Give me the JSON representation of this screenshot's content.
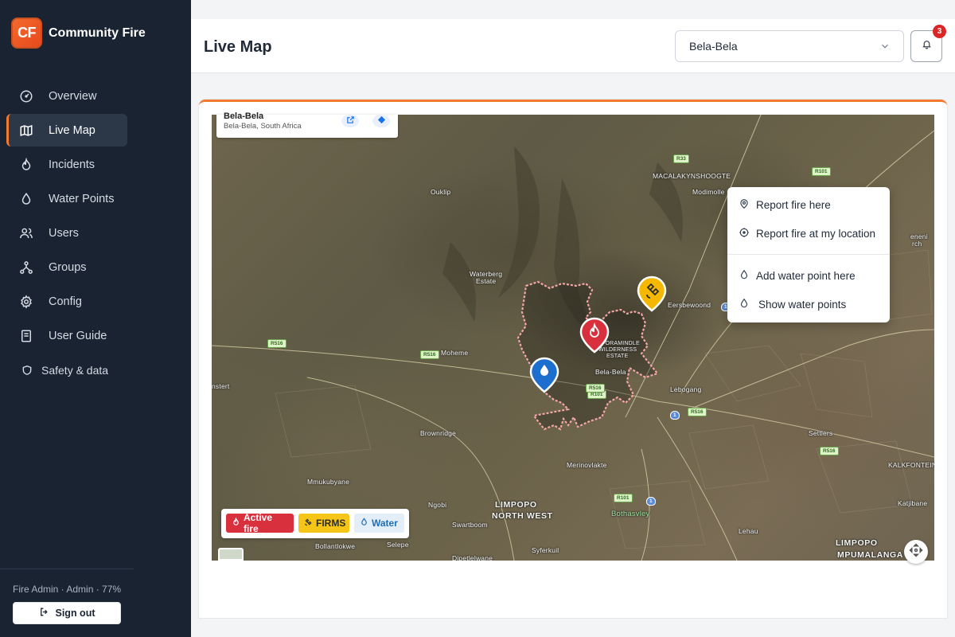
{
  "brand": {
    "logo_text": "CF",
    "name": "Community Fire",
    "accent": "#f07a2e"
  },
  "sidebar": {
    "items": [
      {
        "label": "Overview",
        "icon": "gauge-icon"
      },
      {
        "label": "Live Map",
        "icon": "map-icon",
        "active": true
      },
      {
        "label": "Incidents",
        "icon": "flame-icon"
      },
      {
        "label": "Water Points",
        "icon": "droplet-icon"
      },
      {
        "label": "Users",
        "icon": "users-icon"
      },
      {
        "label": "Groups",
        "icon": "network-icon"
      },
      {
        "label": "Config",
        "icon": "gear-icon"
      },
      {
        "label": "User Guide",
        "icon": "book-icon"
      },
      {
        "label": "Safety & data",
        "icon": "shield-icon"
      }
    ],
    "user_info": "Fire Admin · Admin · 77%",
    "signout_label": "Sign out"
  },
  "header": {
    "title": "Live Map",
    "location_select": "Bela-Bela",
    "notification_count": "3"
  },
  "map": {
    "info_card": {
      "title": "Bela-Bela",
      "subtitle": "Bela-Bela, South Africa"
    },
    "labels": {
      "macalakyn": "MACALAKYNSHOOGTE",
      "modimolle": "Modimolle",
      "ouklip": "Ouklip",
      "waterberg": "Waterberg",
      "estate": "Estate",
      "moheme": "Moheme",
      "eersbewoond": "Eersbewoond",
      "belabela": "Bela-Bela",
      "lebogang": "Lebogang",
      "brownridge": "Brownridge",
      "merinovlakte": "Merinovlakte",
      "settlers": "Settlers",
      "kalkfontein": "KALKFONTEIN",
      "mmukubyane": "Mmukubyane",
      "ngobi": "Ngobi",
      "limpopo": "LIMPOPO",
      "northwest": "NORTH WEST",
      "swartboom": "Swartboom",
      "bothasvley": "Bothasvley",
      "katjibane": "Katjibane",
      "lehau": "Lehau",
      "limpopo2": "LIMPOPO",
      "mpumalanga": "MPUMALANGA",
      "bollantlokwe": "Bollantlokwe",
      "selepe": "Selepe",
      "syferkuil": "Syferkuil",
      "dipetlelwane": "Dipetlelwane",
      "stert": "nstert",
      "enenl": "eneni",
      "rch": "rch",
      "reserve1": "FORAMINDLE",
      "reserve2": "WILDERNESS",
      "reserve3": "ESTATE"
    },
    "roads": {
      "r33": "R33",
      "r101a": "R101",
      "r101b": "R101",
      "r101c": "R101",
      "r516a": "R516",
      "r516b": "R516",
      "r516c": "R516",
      "r516d": "R516",
      "r516e": "R516",
      "n1a": "1",
      "n1b": "1",
      "n1c": "1"
    }
  },
  "context_menu": {
    "report_here": "Report fire here",
    "report_location": "Report fire at my location",
    "add_water": "Add water point here",
    "show_water": "Show water points"
  },
  "legend": {
    "active_fire": "Active fire",
    "firms": "FIRMS",
    "water": "Water"
  },
  "colors": {
    "fire": "#d9303e",
    "firms": "#f5c518",
    "water": "#1e6fb3",
    "sidebar": "#1a2332"
  }
}
